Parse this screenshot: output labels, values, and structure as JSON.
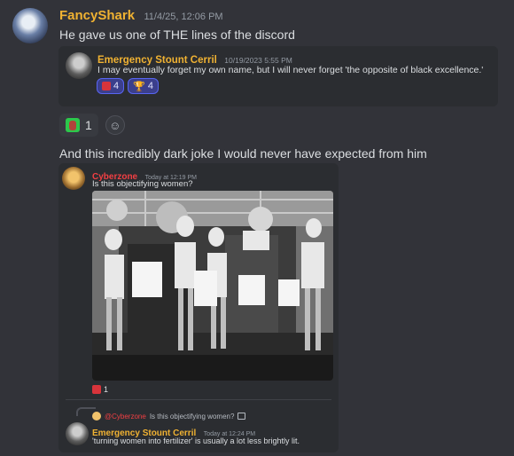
{
  "msg1": {
    "author": "FancyShark",
    "author_color": "#f0b232",
    "timestamp": "11/4/25, 12:06 PM",
    "text": "He gave us one of THE lines of the discord"
  },
  "quote1": {
    "author": "Emergency Stount Cerril",
    "author_color": "#f0b232",
    "timestamp": "10/19/2023 5:55 PM",
    "text": "I may eventually forget my own name, but I will never forget 'the opposite of black excellence.'",
    "reactions": [
      {
        "icon": "chart-icon",
        "count": "4"
      },
      {
        "icon": "trophy-icon",
        "count": "4"
      }
    ]
  },
  "msg1_reactions": [
    {
      "icon": "person-emoji-icon",
      "count": "1"
    }
  ],
  "msg2": {
    "text": "And this incredibly dark joke I would never have expected from him"
  },
  "embed": {
    "author": "Cyberzone",
    "author_color": "#f23f43",
    "timestamp": "Today at 12:19 PM",
    "text": "Is this objectifying women?",
    "reaction_count": "1"
  },
  "reply": {
    "ref_author": "@Cyberzone",
    "ref_text": "Is this objectifying women?",
    "author": "Emergency Stount Cerril",
    "author_color": "#f0b232",
    "timestamp": "Today at 12:24 PM",
    "text": "'turning women into fertilizer' is usually a lot less brightly lit."
  }
}
